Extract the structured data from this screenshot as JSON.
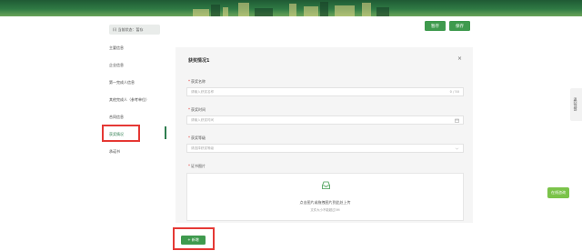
{
  "status": {
    "text": "(i) 当前状态：暂存",
    "icon": "info-circle-icon"
  },
  "toolbar": {
    "save_label": "暂存",
    "submit_label": "保存"
  },
  "nav": {
    "items": [
      {
        "label": "主要信息"
      },
      {
        "label": "企业信息"
      },
      {
        "label": "第一完成人信息"
      },
      {
        "label": "其他完成人（参考单位）"
      },
      {
        "label": "合同信息"
      },
      {
        "label": "获奖情况"
      },
      {
        "label": "承诺书"
      }
    ],
    "active_index": 5
  },
  "award_card": {
    "title": "获奖情况1",
    "close_icon": "×",
    "award_name": {
      "label": "获奖名称",
      "placeholder": "请输入获奖名称",
      "counter": "0 / 50"
    },
    "award_time": {
      "label": "获奖时间",
      "placeholder": "请输入获奖时间"
    },
    "award_level": {
      "label": "获奖等级",
      "placeholder": "请选择获奖等级"
    },
    "certificate": {
      "label": "证书图片",
      "upload_text": "点击图片或拖拽图片到此处上传",
      "upload_hint": "文件大小不能超过5M"
    }
  },
  "add_button": {
    "label": "+ 新增"
  },
  "side_tab": {
    "label": "返回顶部"
  },
  "chat_button": {
    "label": "在线咨询"
  },
  "colors": {
    "accent": "#3f9a4e",
    "highlight": "#e53935"
  }
}
